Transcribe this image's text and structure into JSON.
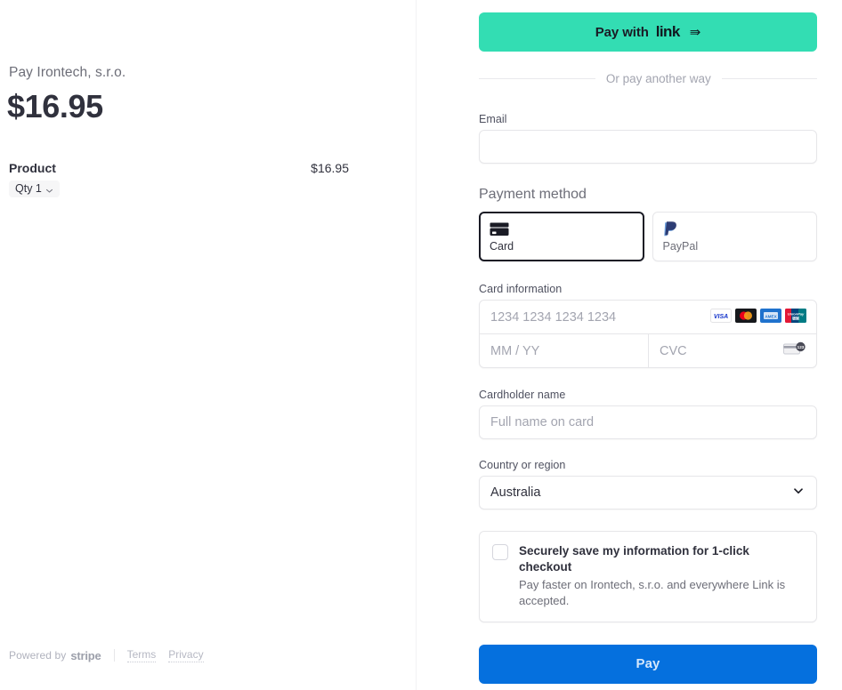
{
  "left": {
    "merchant_line": "Pay Irontech, s.r.o.",
    "amount": "$16.95",
    "line_items": [
      {
        "name": "Product",
        "price": "$16.95",
        "qty_label": "Qty 1"
      }
    ],
    "footer": {
      "powered_by": "Powered by",
      "stripe": "stripe",
      "terms": "Terms",
      "privacy": "Privacy"
    }
  },
  "right": {
    "link_button": {
      "prefix": "Pay with",
      "logo": "link",
      "arrow": "⇛",
      "color": "#33ddb3"
    },
    "divider_text": "Or pay another way",
    "email": {
      "label": "Email",
      "value": "",
      "placeholder": ""
    },
    "payment_method": {
      "label": "Payment method",
      "selected": "Card",
      "options": [
        {
          "label": "Card",
          "icon": "credit-card-icon",
          "selected": true
        },
        {
          "label": "PayPal",
          "icon": "paypal-icon",
          "selected": false
        }
      ]
    },
    "card_information": {
      "label": "Card information",
      "number_placeholder": "1234 1234 1234 1234",
      "number_value": "",
      "expiry_placeholder": "MM / YY",
      "expiry_value": "",
      "cvc_placeholder": "CVC",
      "cvc_value": "",
      "brands": [
        "visa",
        "mastercard",
        "amex",
        "unionpay"
      ]
    },
    "cardholder_name": {
      "label": "Cardholder name",
      "placeholder": "Full name on card",
      "value": ""
    },
    "country": {
      "label": "Country or region",
      "value": "Australia"
    },
    "save_info": {
      "checked": false,
      "title": "Securely save my information for 1-click checkout",
      "subtitle": "Pay faster on Irontech, s.r.o. and everywhere Link is accepted."
    },
    "pay_button": {
      "label": "Pay",
      "color": "#0570de"
    }
  }
}
